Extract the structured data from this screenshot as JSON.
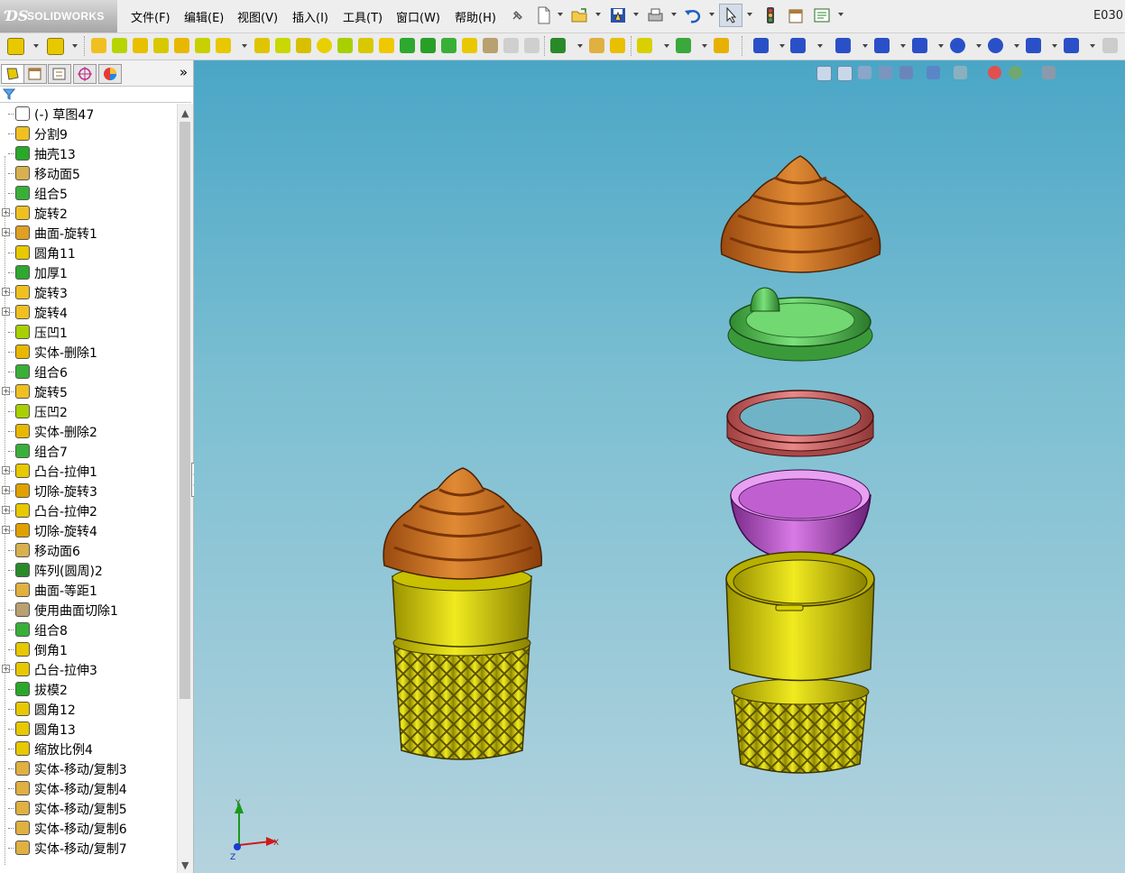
{
  "app": {
    "logo_text": "SOLIDWORKS",
    "file_code": "E030"
  },
  "menu": {
    "items": [
      "文件(F)",
      "编辑(E)",
      "视图(V)",
      "插入(I)",
      "工具(T)",
      "窗口(W)",
      "帮助(H)"
    ]
  },
  "panel": {
    "more_label": "»",
    "tree_items": [
      {
        "label": "(-) 草图47",
        "icon": "sketch-icon",
        "expandable": false
      },
      {
        "label": "分割9",
        "icon": "split-icon",
        "expandable": false
      },
      {
        "label": "抽壳13",
        "icon": "shell-icon",
        "expandable": false
      },
      {
        "label": "移动面5",
        "icon": "move-face-icon",
        "expandable": false
      },
      {
        "label": "组合5",
        "icon": "combine-icon",
        "expandable": false
      },
      {
        "label": "旋转2",
        "icon": "revolve-icon",
        "expandable": true
      },
      {
        "label": "曲面-旋转1",
        "icon": "surface-revolve-icon",
        "expandable": true
      },
      {
        "label": "圆角11",
        "icon": "fillet-icon",
        "expandable": false
      },
      {
        "label": "加厚1",
        "icon": "thicken-icon",
        "expandable": false
      },
      {
        "label": "旋转3",
        "icon": "revolve-icon",
        "expandable": true
      },
      {
        "label": "旋转4",
        "icon": "revolve-icon",
        "expandable": true
      },
      {
        "label": "压凹1",
        "icon": "indent-icon",
        "expandable": false
      },
      {
        "label": "实体-删除1",
        "icon": "delete-body-icon",
        "expandable": false
      },
      {
        "label": "组合6",
        "icon": "combine-icon",
        "expandable": false
      },
      {
        "label": "旋转5",
        "icon": "revolve-icon",
        "expandable": true
      },
      {
        "label": "压凹2",
        "icon": "indent-icon",
        "expandable": false
      },
      {
        "label": "实体-删除2",
        "icon": "delete-body-icon",
        "expandable": false
      },
      {
        "label": "组合7",
        "icon": "combine-icon",
        "expandable": false
      },
      {
        "label": "凸台-拉伸1",
        "icon": "boss-extrude-icon",
        "expandable": true
      },
      {
        "label": "切除-旋转3",
        "icon": "cut-revolve-icon",
        "expandable": true
      },
      {
        "label": "凸台-拉伸2",
        "icon": "boss-extrude-icon",
        "expandable": true
      },
      {
        "label": "切除-旋转4",
        "icon": "cut-revolve-icon",
        "expandable": true
      },
      {
        "label": "移动面6",
        "icon": "move-face-icon",
        "expandable": false
      },
      {
        "label": "阵列(圆周)2",
        "icon": "circular-pattern-icon",
        "expandable": false
      },
      {
        "label": "曲面-等距1",
        "icon": "offset-surface-icon",
        "expandable": false
      },
      {
        "label": "使用曲面切除1",
        "icon": "surface-cut-icon",
        "expandable": false
      },
      {
        "label": "组合8",
        "icon": "combine-icon",
        "expandable": false
      },
      {
        "label": "倒角1",
        "icon": "chamfer-icon",
        "expandable": false
      },
      {
        "label": "凸台-拉伸3",
        "icon": "boss-extrude-icon",
        "expandable": true
      },
      {
        "label": "拔模2",
        "icon": "draft-icon",
        "expandable": false
      },
      {
        "label": "圆角12",
        "icon": "fillet-icon",
        "expandable": false
      },
      {
        "label": "圆角13",
        "icon": "fillet-icon",
        "expandable": false
      },
      {
        "label": "缩放比例4",
        "icon": "scale-icon",
        "expandable": false
      },
      {
        "label": "实体-移动/复制3",
        "icon": "move-copy-body-icon",
        "expandable": false
      },
      {
        "label": "实体-移动/复制4",
        "icon": "move-copy-body-icon",
        "expandable": false
      },
      {
        "label": "实体-移动/复制5",
        "icon": "move-copy-body-icon",
        "expandable": false
      },
      {
        "label": "实体-移动/复制6",
        "icon": "move-copy-body-icon",
        "expandable": false
      },
      {
        "label": "实体-移动/复制7",
        "icon": "move-copy-body-icon",
        "expandable": false
      }
    ]
  },
  "triad": {
    "x_label": "X",
    "y_label": "Y",
    "z_label": "Z"
  },
  "colors": {
    "viewport_top": "#4aa6c6",
    "viewport_bottom": "#b4d3de",
    "cream_top": "#c86a1c",
    "lid": "#5fd05f",
    "ring": "#cf6a6a",
    "cup": "#b34dc2",
    "cone": "#d8d400"
  }
}
